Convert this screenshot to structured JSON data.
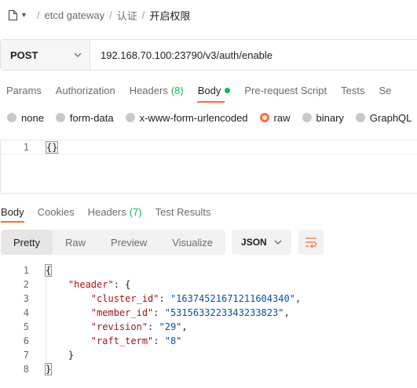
{
  "breadcrumb": {
    "collection": "etcd gateway",
    "folder": "认证",
    "request": "开启权限",
    "separator": "/"
  },
  "request": {
    "method": "POST",
    "url": "192.168.70.100:23790/v3/auth/enable"
  },
  "tabs": [
    {
      "label": "Params"
    },
    {
      "label": "Authorization"
    },
    {
      "label": "Headers",
      "count": "(8)"
    },
    {
      "label": "Body"
    },
    {
      "label": "Pre-request Script"
    },
    {
      "label": "Tests"
    },
    {
      "label": "Se"
    }
  ],
  "body_types": [
    {
      "label": "none",
      "selected": false
    },
    {
      "label": "form-data",
      "selected": false
    },
    {
      "label": "x-www-form-urlencoded",
      "selected": false
    },
    {
      "label": "raw",
      "selected": true
    },
    {
      "label": "binary",
      "selected": false
    },
    {
      "label": "GraphQL",
      "selected": false
    }
  ],
  "request_editor": {
    "line": "1",
    "code": "{}"
  },
  "response_tabs": [
    {
      "label": "Body"
    },
    {
      "label": "Cookies"
    },
    {
      "label": "Headers",
      "count": "(7)"
    },
    {
      "label": "Test Results"
    }
  ],
  "view_modes": [
    "Pretty",
    "Raw",
    "Preview",
    "Visualize"
  ],
  "format": "JSON",
  "response": {
    "lines": [
      "1",
      "2",
      "3",
      "4",
      "5",
      "6",
      "7",
      "8"
    ],
    "open_brace": "{",
    "close_brace": "}",
    "header_key": "\"header\"",
    "header_open": ": {",
    "header_close": "}",
    "fields": [
      {
        "key": "\"cluster_id\"",
        "value": "\"16374521671211604340\""
      },
      {
        "key": "\"member_id\"",
        "value": "\"5315633223343233823\""
      },
      {
        "key": "\"revision\"",
        "value": "\"29\""
      },
      {
        "key": "\"raft_term\"",
        "value": "\"8\""
      }
    ]
  },
  "colors": {
    "accent": "#ff6c37",
    "success": "#0cbb52",
    "json_key": "#a31515",
    "json_string": "#0451a5"
  }
}
